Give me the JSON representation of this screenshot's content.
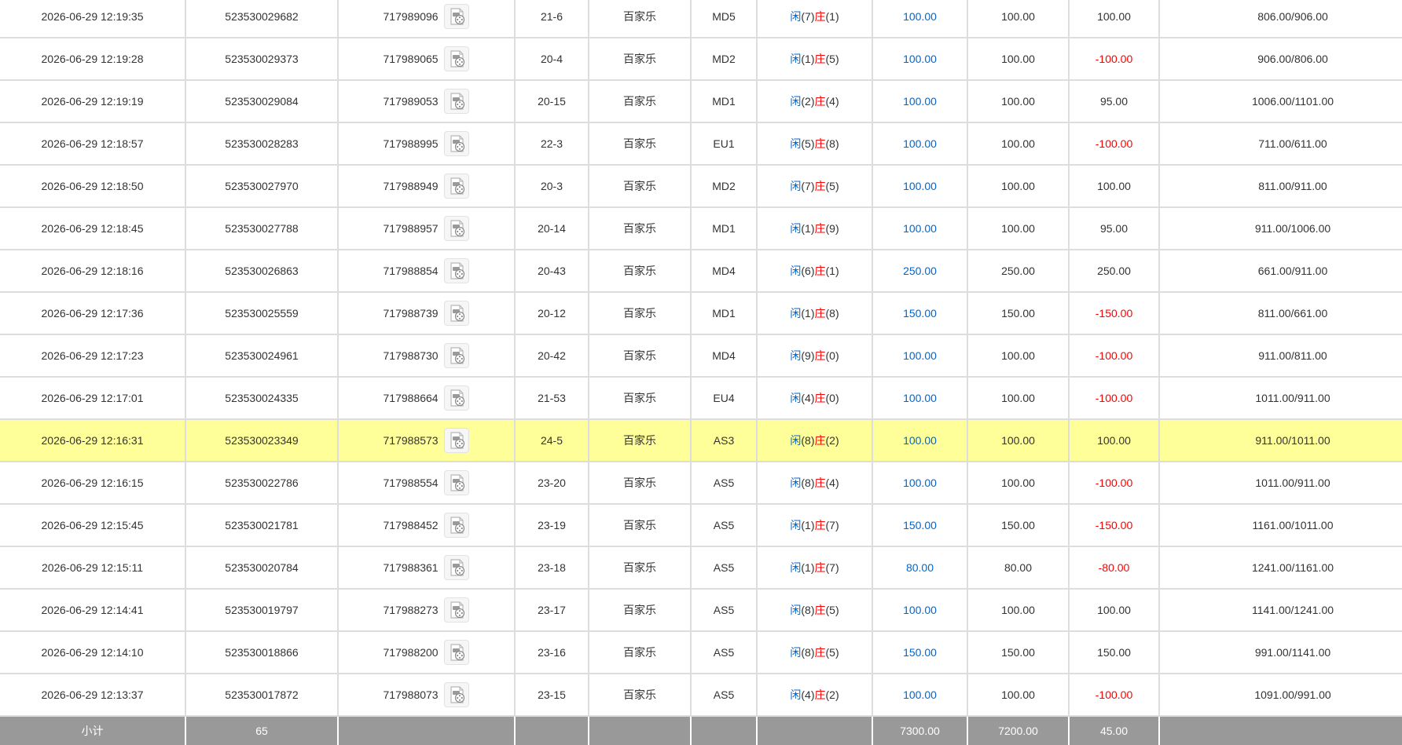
{
  "rows": [
    {
      "time": "2026-06-29 12:19:35",
      "order_no": "523530029682",
      "round_no": "717989096",
      "shoe": "21-6",
      "game": "百家乐",
      "table": "MD5",
      "player_label": "闲",
      "player_pts": "(7)",
      "banker_label": "庄",
      "banker_pts": "(1)",
      "bet": "100.00",
      "valid_bet": "100.00",
      "win_loss": "100.00",
      "win_loss_negative": false,
      "balance": "806.00/906.00",
      "highlight": false
    },
    {
      "time": "2026-06-29 12:19:28",
      "order_no": "523530029373",
      "round_no": "717989065",
      "shoe": "20-4",
      "game": "百家乐",
      "table": "MD2",
      "player_label": "闲",
      "player_pts": "(1)",
      "banker_label": "庄",
      "banker_pts": "(5)",
      "bet": "100.00",
      "valid_bet": "100.00",
      "win_loss": "-100.00",
      "win_loss_negative": true,
      "balance": "906.00/806.00",
      "highlight": false
    },
    {
      "time": "2026-06-29 12:19:19",
      "order_no": "523530029084",
      "round_no": "717989053",
      "shoe": "20-15",
      "game": "百家乐",
      "table": "MD1",
      "player_label": "闲",
      "player_pts": "(2)",
      "banker_label": "庄",
      "banker_pts": "(4)",
      "bet": "100.00",
      "valid_bet": "100.00",
      "win_loss": "95.00",
      "win_loss_negative": false,
      "balance": "1006.00/1101.00",
      "highlight": false
    },
    {
      "time": "2026-06-29 12:18:57",
      "order_no": "523530028283",
      "round_no": "717988995",
      "shoe": "22-3",
      "game": "百家乐",
      "table": "EU1",
      "player_label": "闲",
      "player_pts": "(5)",
      "banker_label": "庄",
      "banker_pts": "(8)",
      "bet": "100.00",
      "valid_bet": "100.00",
      "win_loss": "-100.00",
      "win_loss_negative": true,
      "balance": "711.00/611.00",
      "highlight": false
    },
    {
      "time": "2026-06-29 12:18:50",
      "order_no": "523530027970",
      "round_no": "717988949",
      "shoe": "20-3",
      "game": "百家乐",
      "table": "MD2",
      "player_label": "闲",
      "player_pts": "(7)",
      "banker_label": "庄",
      "banker_pts": "(5)",
      "bet": "100.00",
      "valid_bet": "100.00",
      "win_loss": "100.00",
      "win_loss_negative": false,
      "balance": "811.00/911.00",
      "highlight": false
    },
    {
      "time": "2026-06-29 12:18:45",
      "order_no": "523530027788",
      "round_no": "717988957",
      "shoe": "20-14",
      "game": "百家乐",
      "table": "MD1",
      "player_label": "闲",
      "player_pts": "(1)",
      "banker_label": "庄",
      "banker_pts": "(9)",
      "bet": "100.00",
      "valid_bet": "100.00",
      "win_loss": "95.00",
      "win_loss_negative": false,
      "balance": "911.00/1006.00",
      "highlight": false
    },
    {
      "time": "2026-06-29 12:18:16",
      "order_no": "523530026863",
      "round_no": "717988854",
      "shoe": "20-43",
      "game": "百家乐",
      "table": "MD4",
      "player_label": "闲",
      "player_pts": "(6)",
      "banker_label": "庄",
      "banker_pts": "(1)",
      "bet": "250.00",
      "valid_bet": "250.00",
      "win_loss": "250.00",
      "win_loss_negative": false,
      "balance": "661.00/911.00",
      "highlight": false
    },
    {
      "time": "2026-06-29 12:17:36",
      "order_no": "523530025559",
      "round_no": "717988739",
      "shoe": "20-12",
      "game": "百家乐",
      "table": "MD1",
      "player_label": "闲",
      "player_pts": "(1)",
      "banker_label": "庄",
      "banker_pts": "(8)",
      "bet": "150.00",
      "valid_bet": "150.00",
      "win_loss": "-150.00",
      "win_loss_negative": true,
      "balance": "811.00/661.00",
      "highlight": false
    },
    {
      "time": "2026-06-29 12:17:23",
      "order_no": "523530024961",
      "round_no": "717988730",
      "shoe": "20-42",
      "game": "百家乐",
      "table": "MD4",
      "player_label": "闲",
      "player_pts": "(9)",
      "banker_label": "庄",
      "banker_pts": "(0)",
      "bet": "100.00",
      "valid_bet": "100.00",
      "win_loss": "-100.00",
      "win_loss_negative": true,
      "balance": "911.00/811.00",
      "highlight": false
    },
    {
      "time": "2026-06-29 12:17:01",
      "order_no": "523530024335",
      "round_no": "717988664",
      "shoe": "21-53",
      "game": "百家乐",
      "table": "EU4",
      "player_label": "闲",
      "player_pts": "(4)",
      "banker_label": "庄",
      "banker_pts": "(0)",
      "bet": "100.00",
      "valid_bet": "100.00",
      "win_loss": "-100.00",
      "win_loss_negative": true,
      "balance": "1011.00/911.00",
      "highlight": false
    },
    {
      "time": "2026-06-29 12:16:31",
      "order_no": "523530023349",
      "round_no": "717988573",
      "shoe": "24-5",
      "game": "百家乐",
      "table": "AS3",
      "player_label": "闲",
      "player_pts": "(8)",
      "banker_label": "庄",
      "banker_pts": "(2)",
      "bet": "100.00",
      "valid_bet": "100.00",
      "win_loss": "100.00",
      "win_loss_negative": false,
      "balance": "911.00/1011.00",
      "highlight": true
    },
    {
      "time": "2026-06-29 12:16:15",
      "order_no": "523530022786",
      "round_no": "717988554",
      "shoe": "23-20",
      "game": "百家乐",
      "table": "AS5",
      "player_label": "闲",
      "player_pts": "(8)",
      "banker_label": "庄",
      "banker_pts": "(4)",
      "bet": "100.00",
      "valid_bet": "100.00",
      "win_loss": "-100.00",
      "win_loss_negative": true,
      "balance": "1011.00/911.00",
      "highlight": false
    },
    {
      "time": "2026-06-29 12:15:45",
      "order_no": "523530021781",
      "round_no": "717988452",
      "shoe": "23-19",
      "game": "百家乐",
      "table": "AS5",
      "player_label": "闲",
      "player_pts": "(1)",
      "banker_label": "庄",
      "banker_pts": "(7)",
      "bet": "150.00",
      "valid_bet": "150.00",
      "win_loss": "-150.00",
      "win_loss_negative": true,
      "balance": "1161.00/1011.00",
      "highlight": false
    },
    {
      "time": "2026-06-29 12:15:11",
      "order_no": "523530020784",
      "round_no": "717988361",
      "shoe": "23-18",
      "game": "百家乐",
      "table": "AS5",
      "player_label": "闲",
      "player_pts": "(1)",
      "banker_label": "庄",
      "banker_pts": "(7)",
      "bet": "80.00",
      "valid_bet": "80.00",
      "win_loss": "-80.00",
      "win_loss_negative": true,
      "balance": "1241.00/1161.00",
      "highlight": false
    },
    {
      "time": "2026-06-29 12:14:41",
      "order_no": "523530019797",
      "round_no": "717988273",
      "shoe": "23-17",
      "game": "百家乐",
      "table": "AS5",
      "player_label": "闲",
      "player_pts": "(8)",
      "banker_label": "庄",
      "banker_pts": "(5)",
      "bet": "100.00",
      "valid_bet": "100.00",
      "win_loss": "100.00",
      "win_loss_negative": false,
      "balance": "1141.00/1241.00",
      "highlight": false
    },
    {
      "time": "2026-06-29 12:14:10",
      "order_no": "523530018866",
      "round_no": "717988200",
      "shoe": "23-16",
      "game": "百家乐",
      "table": "AS5",
      "player_label": "闲",
      "player_pts": "(8)",
      "banker_label": "庄",
      "banker_pts": "(5)",
      "bet": "150.00",
      "valid_bet": "150.00",
      "win_loss": "150.00",
      "win_loss_negative": false,
      "balance": "991.00/1141.00",
      "highlight": false
    },
    {
      "time": "2026-06-29 12:13:37",
      "order_no": "523530017872",
      "round_no": "717988073",
      "shoe": "23-15",
      "game": "百家乐",
      "table": "AS5",
      "player_label": "闲",
      "player_pts": "(4)",
      "banker_label": "庄",
      "banker_pts": "(2)",
      "bet": "100.00",
      "valid_bet": "100.00",
      "win_loss": "-100.00",
      "win_loss_negative": true,
      "balance": "1091.00/991.00",
      "highlight": false
    }
  ],
  "subtotal": {
    "label": "小计",
    "count": "65",
    "bet": "7300.00",
    "valid_bet": "7200.00",
    "win_loss": "45.00"
  },
  "icons": {
    "replay": "video-replay-icon"
  },
  "colors": {
    "blue_text": "#0066cc",
    "red_text": "#ff0000",
    "highlight_row": "#ffff99",
    "subtotal_bg": "#999999",
    "grid_line": "#dddddd"
  }
}
